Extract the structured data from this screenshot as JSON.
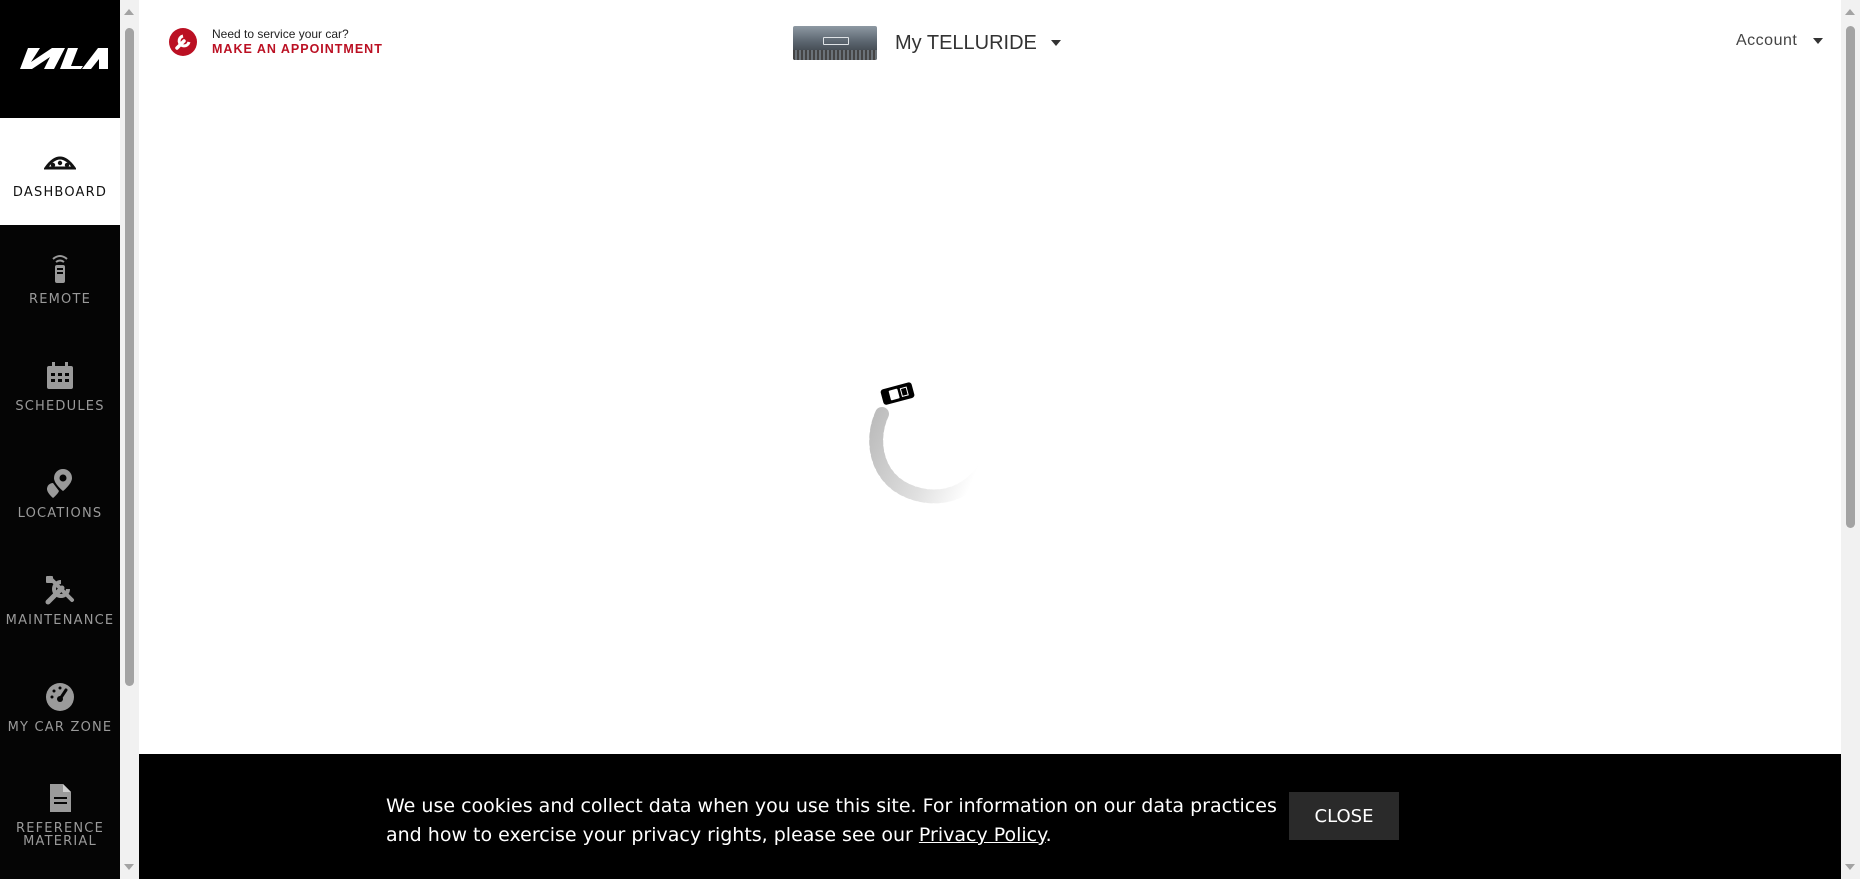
{
  "brand": {
    "logo_text": "KIA"
  },
  "sidebar": {
    "items": [
      {
        "label": "DASHBOARD",
        "icon": "dashboard-icon",
        "active": true
      },
      {
        "label": "REMOTE",
        "icon": "remote-icon",
        "active": false
      },
      {
        "label": "SCHEDULES",
        "icon": "calendar-icon",
        "active": false
      },
      {
        "label": "LOCATIONS",
        "icon": "location-pin-icon",
        "active": false
      },
      {
        "label": "MAINTENANCE",
        "icon": "wrench-screwdriver-icon",
        "active": false
      },
      {
        "label": "MY CAR ZONE",
        "icon": "speedometer-icon",
        "active": false
      },
      {
        "label": "REFERENCE MATERIAL",
        "icon": "document-icon",
        "active": false
      }
    ]
  },
  "header": {
    "service_prompt": "Need to service your car?",
    "service_cta": "MAKE AN APPOINTMENT",
    "vehicle_name": "My TELLURIDE",
    "account_label": "Account"
  },
  "cookie_banner": {
    "message": "We use cookies and collect data when you use this site. For information on our data practices and how to exercise your privacy rights, please see our ",
    "link_text": "Privacy Policy",
    "suffix": ".",
    "close_label": "CLOSE"
  },
  "colors": {
    "accent_red": "#bb1023",
    "sidebar_bg": "#050505",
    "banner_bg": "#000000"
  }
}
